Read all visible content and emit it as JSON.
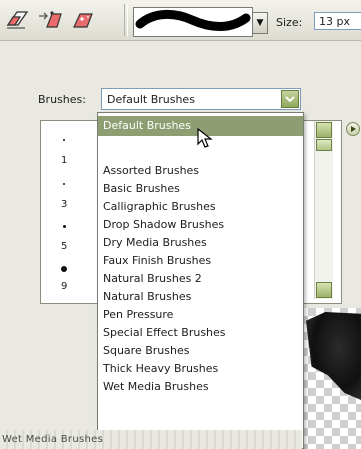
{
  "toolbar": {
    "size_label": "Size:",
    "size_value": "13 px"
  },
  "brushes_panel": {
    "label": "Brushes:",
    "selected": "Default Brushes",
    "brush_sizes": [
      "1",
      "3",
      "5",
      "9"
    ]
  },
  "dropdown": {
    "highlighted": "Default Brushes",
    "items": [
      "Assorted Brushes",
      "Basic Brushes",
      "Calligraphic Brushes",
      "Drop Shadow Brushes",
      "Dry Media Brushes",
      "Faux Finish Brushes",
      "Natural Brushes 2",
      "Natural Brushes",
      "Pen Pressure",
      "Special Effect Brushes",
      "Square Brushes",
      "Thick Heavy Brushes"
    ],
    "partial_item": "Wet Media Brushes"
  },
  "bottom_status": "Wet Media Brushes",
  "icons": {
    "tool1": "eraser-icon",
    "tool2": "background-eraser-icon",
    "tool3": "magic-eraser-icon",
    "brush_arrow": "chevron-down-icon",
    "combo_arrow": "chevron-down-icon",
    "play": "play-icon",
    "cursor": "mouse-pointer-icon"
  },
  "colors": {
    "highlight": "#8f9e72",
    "accent_green": "#9db26b",
    "tool_pink": "#e96b6b"
  }
}
